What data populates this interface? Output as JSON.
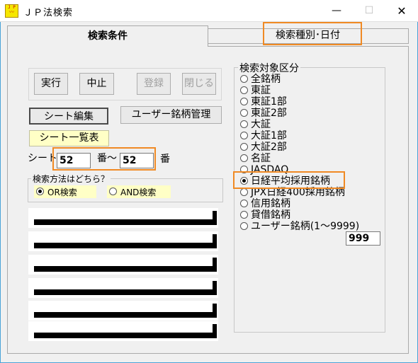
{
  "window": {
    "title": "ＪＰ法検索",
    "minimize": "—",
    "maximize": "☐",
    "close": "✕",
    "icon_text_top": "J P",
    "icon_text_bottom": "〰"
  },
  "tabs": [
    {
      "label": "検索条件",
      "active": true
    },
    {
      "label": "検索種別･日付",
      "active": false
    }
  ],
  "buttons": {
    "run": "実行",
    "stop": "中止",
    "register": "登録",
    "close": "閉じる",
    "sheet_edit": "シート編集",
    "user_stock_manage": "ユーザー銘柄管理",
    "sheet_list": "シート一覧表"
  },
  "sheet_range": {
    "label_prefix": "シート",
    "from_value": "52",
    "middle_label": "番〜",
    "to_value": "52",
    "suffix": "番"
  },
  "search_method": {
    "title": "検索方法はどちら？",
    "options": [
      {
        "label": "OR検索",
        "checked": true
      },
      {
        "label": "AND検索",
        "checked": false
      }
    ]
  },
  "target_group": {
    "title": "検索対象区分",
    "items": [
      {
        "label": "全銘柄",
        "checked": false
      },
      {
        "label": "東証",
        "checked": false
      },
      {
        "label": "東証1部",
        "checked": false
      },
      {
        "label": "東証2部",
        "checked": false
      },
      {
        "label": "大証",
        "checked": false
      },
      {
        "label": "大証1部",
        "checked": false
      },
      {
        "label": "大証2部",
        "checked": false
      },
      {
        "label": "名証",
        "checked": false
      },
      {
        "label": "JASDAQ",
        "checked": false
      },
      {
        "label": "日経平均採用銘柄",
        "checked": true
      },
      {
        "label": "JPX日経400採用銘柄",
        "checked": false
      },
      {
        "label": "信用銘柄",
        "checked": false
      },
      {
        "label": "貸借銘柄",
        "checked": false
      },
      {
        "label": "ユーザー銘柄(1〜9999)",
        "checked": false
      }
    ],
    "user_number": "999"
  },
  "colors": {
    "highlight": "#f08a24",
    "yellow_button": "#ffffc6",
    "window_border": "#4aa3d8"
  }
}
